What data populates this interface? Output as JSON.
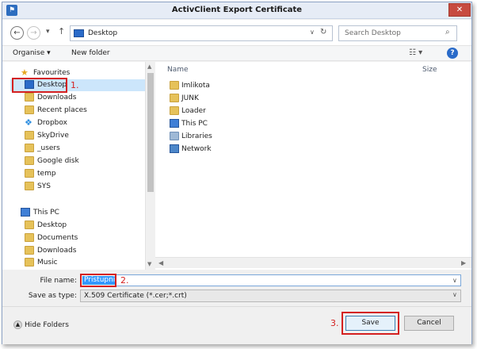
{
  "window": {
    "title": "ActivClient Export Certificate",
    "close_glyph": "✕",
    "app_icon_glyph": "⚑"
  },
  "nav": {
    "back_glyph": "←",
    "forward_glyph": "→",
    "dropdown_glyph": "▾",
    "up_glyph": "↑"
  },
  "address": {
    "location": "Desktop",
    "dropdown_glyph": "∨",
    "refresh_glyph": "↻"
  },
  "search": {
    "placeholder": "Search Desktop",
    "icon_glyph": "⌕"
  },
  "toolbar": {
    "organise_label": "Organise ▾",
    "new_folder_label": "New folder",
    "view_glyph": "☷ ▾",
    "help_glyph": "?"
  },
  "sidebar": {
    "favourites": [
      {
        "label": "Favourites",
        "icon": "star-icon"
      },
      {
        "label": "Desktop",
        "icon": "desktop-icon"
      },
      {
        "label": "Downloads",
        "icon": "folder-icon"
      },
      {
        "label": "Recent places",
        "icon": "folder-icon"
      },
      {
        "label": "Dropbox",
        "icon": "dropbox-icon"
      },
      {
        "label": "SkyDrive",
        "icon": "folder-icon"
      },
      {
        "label": "_users",
        "icon": "folder-icon"
      },
      {
        "label": "Google disk",
        "icon": "folder-icon"
      },
      {
        "label": "temp",
        "icon": "folder-icon"
      },
      {
        "label": "SYS",
        "icon": "folder-icon"
      }
    ],
    "this_pc": [
      {
        "label": "This PC",
        "icon": "computer-icon"
      },
      {
        "label": "Desktop",
        "icon": "desktop-icon"
      },
      {
        "label": "Documents",
        "icon": "folder-icon"
      },
      {
        "label": "Downloads",
        "icon": "folder-icon"
      },
      {
        "label": "Music",
        "icon": "folder-icon"
      }
    ]
  },
  "files": {
    "col_name": "Name",
    "col_size": "Size",
    "items": [
      {
        "label": "Imlikota",
        "icon": "user-folder-icon"
      },
      {
        "label": "JUNK",
        "icon": "folder-icon"
      },
      {
        "label": "Loader",
        "icon": "folder-icon"
      },
      {
        "label": "This PC",
        "icon": "computer-icon"
      },
      {
        "label": "Libraries",
        "icon": "library-icon"
      },
      {
        "label": "Network",
        "icon": "network-icon"
      }
    ]
  },
  "form": {
    "file_name_label": "File name:",
    "file_name_value": "Pristupni",
    "save_type_label": "Save as type:",
    "save_type_value": "X.509 Certificate (*.cer;*.crt)"
  },
  "buttons": {
    "hide_folders": "Hide Folders",
    "save": "Save",
    "cancel": "Cancel"
  },
  "annotations": {
    "step1": "1.",
    "step2": "2.",
    "step3": "3."
  },
  "colors": {
    "annotation_red": "#d42020",
    "selection_blue": "#3399ff"
  }
}
